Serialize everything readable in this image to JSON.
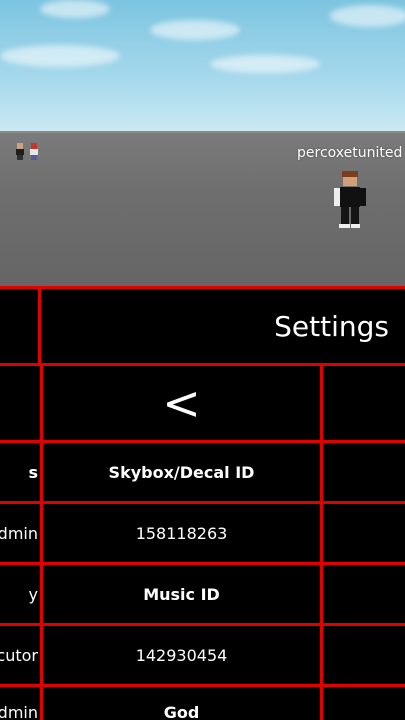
{
  "scene": {
    "player_name": "percoxetunited"
  },
  "panel": {
    "title": "Settings",
    "back_button": "<",
    "left_column": [
      "s",
      "dmin",
      "y",
      "cutor",
      "dmin"
    ],
    "fields": [
      {
        "label": "Skybox/Decal ID",
        "value": "158118263"
      },
      {
        "label": "Music ID",
        "value": "142930454"
      },
      {
        "label": "God"
      }
    ]
  },
  "colors": {
    "border": "#e00000",
    "panel_bg": "#000000",
    "text": "#ffffff",
    "sky": "#8ccde5",
    "ground": "#6e6e6e"
  }
}
